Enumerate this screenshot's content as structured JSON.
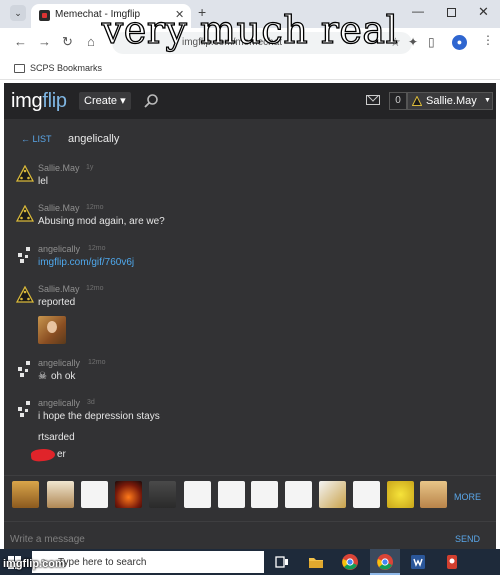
{
  "meme": {
    "caption": "very much real",
    "watermark": "imgflip.com"
  },
  "browser": {
    "tab_title": "Memechat - Imgflip",
    "tab_close": "✕",
    "new_tab": "+",
    "url": "imgflip.com/memechat",
    "bookmarks_label": "SCPS Bookmarks"
  },
  "header": {
    "logo_img": "img",
    "logo_flip": "flip",
    "create_label": "Create ▾",
    "points": "0",
    "username": "Sallie.May",
    "caret": "▼"
  },
  "chat": {
    "back_label": "← LIST",
    "title": "angelically",
    "messages": [
      {
        "author": "Sallie.May",
        "time": "1y",
        "text": "lel",
        "avatar": "sallie-triangle-avatar"
      },
      {
        "author": "Sallie.May",
        "time": "12mo",
        "text": "Abusing mod again, are we?",
        "avatar": "sallie-triangle-avatar"
      },
      {
        "author": "angelically",
        "time": "12mo",
        "text": "imgflip.com/gif/760v6j",
        "avatar": "angelically-pixel-avatar"
      },
      {
        "author": "Sallie.May",
        "time": "12mo",
        "text": "reported",
        "avatar": "sallie-triangle-avatar"
      },
      {
        "author": "angelically",
        "time": "12mo",
        "text": "oh ok",
        "skull": "☠",
        "avatar": "angelically-pixel-avatar"
      },
      {
        "author": "angelically",
        "time": "3d",
        "text": "i hope the depression stays",
        "avatar": "angelically-pixel-avatar"
      }
    ],
    "extra_lines": [
      "rtsarded",
      "er"
    ],
    "more_label": "MORE",
    "compose_placeholder": "Write a message",
    "send_label": "SEND"
  },
  "taskbar": {
    "search_placeholder": "Type here to search"
  },
  "colors": {
    "page_bg": "#323234",
    "header_bg": "#242426",
    "link": "#5aa6e8",
    "accent_red": "#e0242a"
  }
}
